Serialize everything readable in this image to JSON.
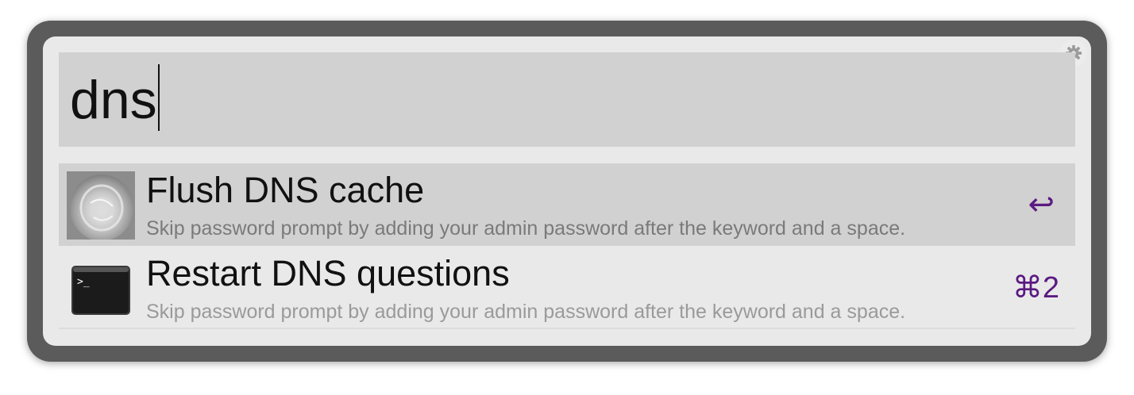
{
  "search": {
    "query": "dns"
  },
  "results": [
    {
      "title": "Flush DNS cache",
      "subtitle": "Skip password prompt by adding your admin password after the keyword and a space.",
      "shortcut": "↩",
      "icon": "toilet-flush-photo-icon",
      "selected": true
    },
    {
      "title": "Restart DNS questions",
      "subtitle": "Skip password prompt by adding your admin password after the keyword and a space.",
      "shortcut": "⌘2",
      "icon": "terminal-icon",
      "selected": false
    }
  ],
  "colors": {
    "frame": "#5b5b5b",
    "panel": "#e9e9e9",
    "selection": "#d1d1d1",
    "shortcut": "#5a1a82"
  }
}
